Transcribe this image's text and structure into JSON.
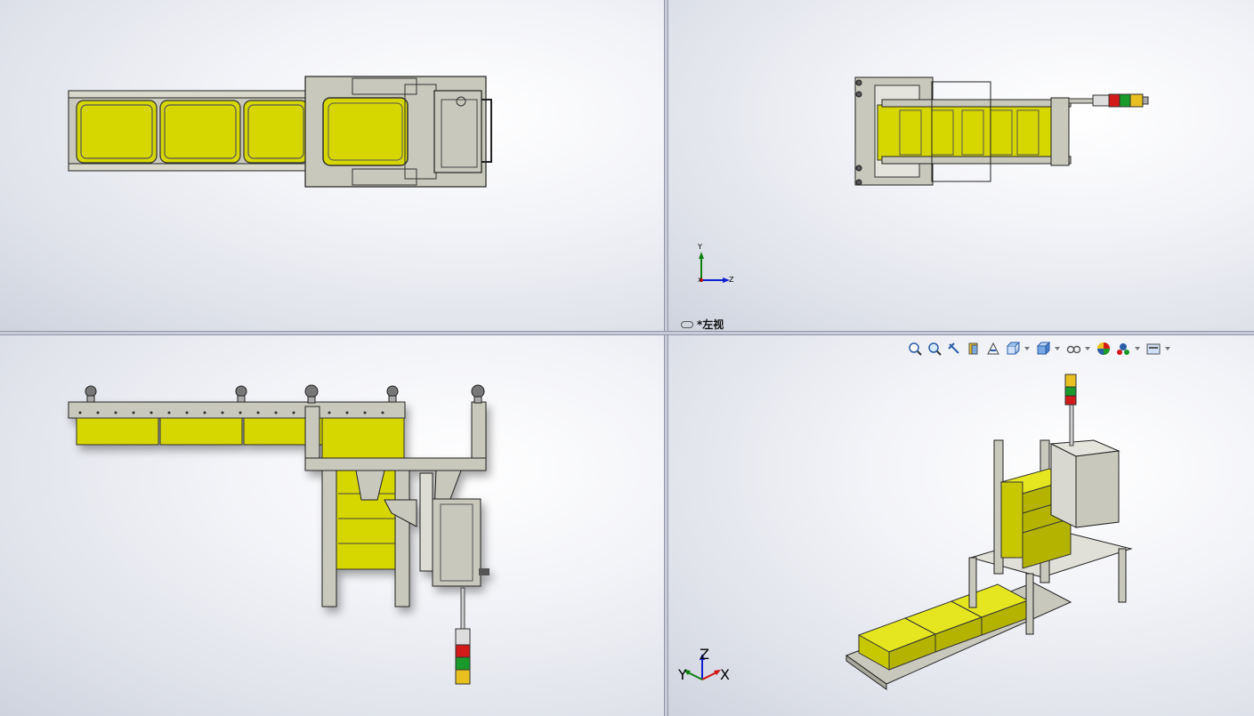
{
  "viewports": {
    "top_left": {},
    "top_right": {
      "label": "*左视",
      "triad": {
        "y": "Y",
        "x": "X",
        "z": "Z"
      }
    },
    "bottom_left": {},
    "bottom_right": {
      "triad": {
        "z": "Z",
        "y": "Y",
        "x": "X"
      }
    }
  },
  "heads_up_toolbar": [
    {
      "name": "zoom-to-fit-icon"
    },
    {
      "name": "zoom-to-area-icon"
    },
    {
      "name": "previous-view-icon"
    },
    {
      "name": "section-view-icon"
    },
    {
      "name": "dynamic-annotation-icon"
    },
    {
      "name": "view-orientation-icon",
      "dropdown": true
    },
    {
      "name": "display-style-icon",
      "dropdown": true
    },
    {
      "name": "hide-show-items-icon",
      "dropdown": true
    },
    {
      "name": "edit-appearance-icon"
    },
    {
      "name": "apply-scene-icon",
      "dropdown": true
    },
    {
      "name": "view-settings-icon",
      "dropdown": true
    }
  ],
  "colors": {
    "bin_yellow": "#d6d600",
    "frame_gray": "#c8c8bc",
    "outline": "#222222",
    "light_red": "#d21a1a",
    "light_green": "#1a9a2a",
    "light_amber": "#e8c020",
    "axis_x": "#d01010",
    "axis_y": "#108010",
    "axis_z": "#1020d0"
  }
}
